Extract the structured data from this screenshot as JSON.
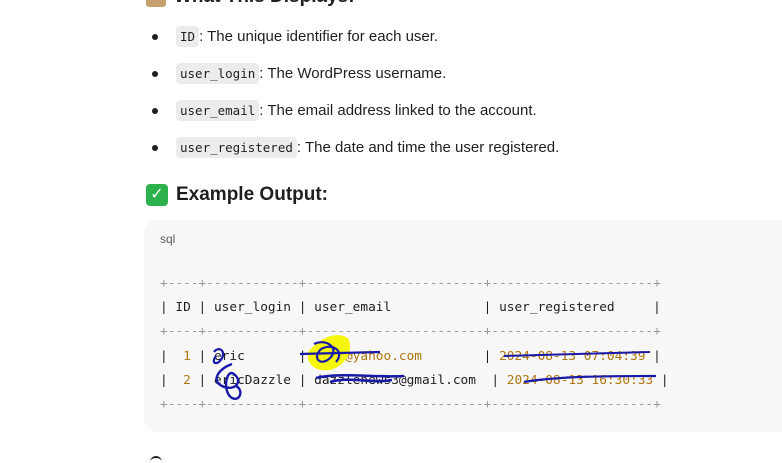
{
  "section_prev": {
    "title": "What This Displays:",
    "emoji": "clipboard-icon"
  },
  "bullets": [
    {
      "code": "ID",
      "text": ": The unique identifier for each user."
    },
    {
      "code": "user_login",
      "text": ": The WordPress username."
    },
    {
      "code": "user_email",
      "text": ": The email address linked to the account."
    },
    {
      "code": "user_registered",
      "text": ": The date and time the user registered."
    }
  ],
  "example": {
    "icon": "check-mark-icon",
    "check_glyph": "✓",
    "title": "Example Output:"
  },
  "code_block": {
    "language": "sql",
    "separator": "+----+------------+-----------------------+---------------------+",
    "header": {
      "id": "ID",
      "login": "user_login",
      "email": "user_email",
      "registered": "user_registered"
    },
    "rows": [
      {
        "id": "1",
        "login": "eric",
        "email_visible": "@yahoo.com",
        "email_hidden": "ec72",
        "registered": "2024-08-13 07:04:39"
      },
      {
        "id": "2",
        "login": "ericDazzle",
        "email_visible": "3@gmail.com",
        "email_hidden": "dazzlenews",
        "registered": "2024-08-13 16:30:33"
      }
    ]
  },
  "colors": {
    "accent_check": "#2bb24c",
    "code_bg": "#f7f7f7",
    "literal": "#b0760c",
    "annotation_ink": "#1a1aa8",
    "highlight": "#f5f500"
  }
}
